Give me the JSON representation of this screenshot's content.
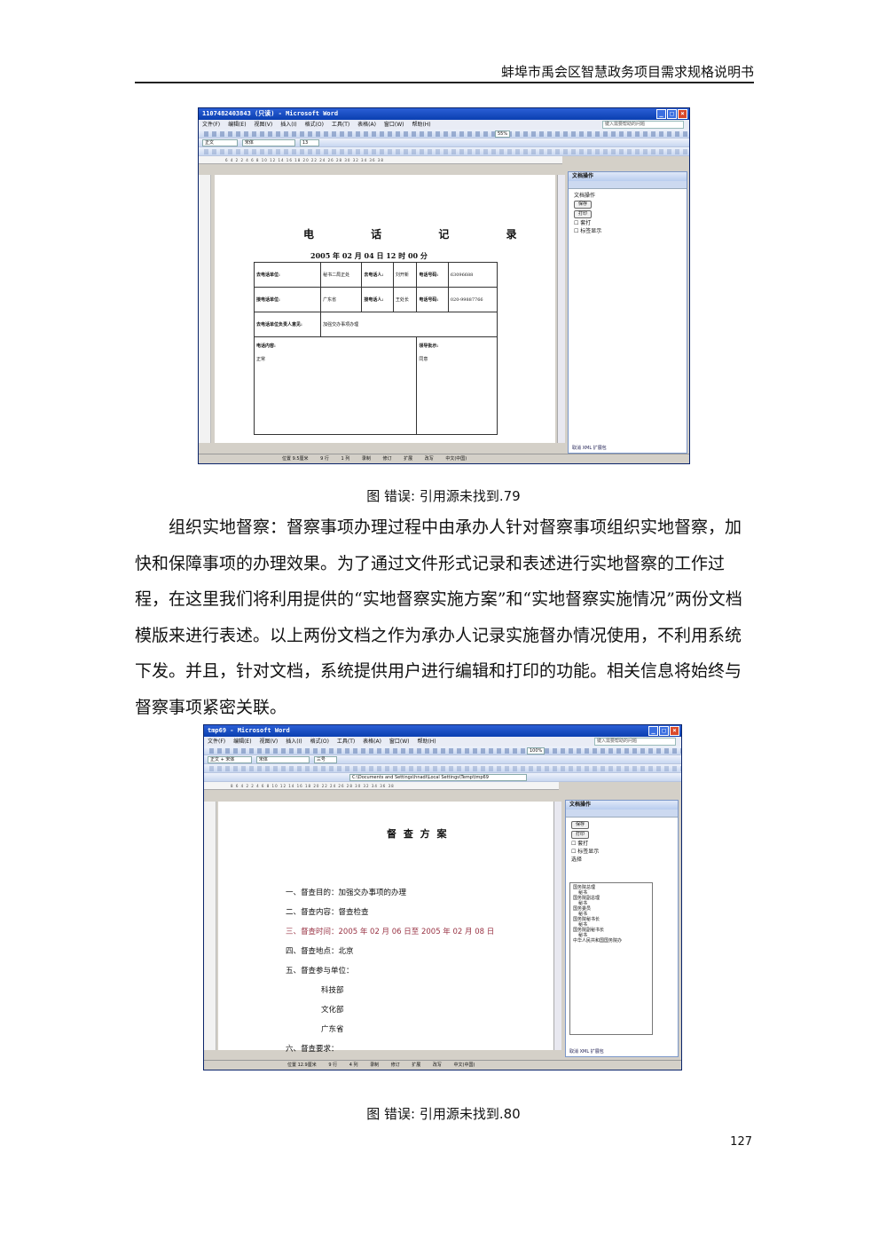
{
  "header": {
    "title": "蚌埠市禹会区智慧政务项目需求规格说明书"
  },
  "figure1": {
    "caption": "图  错误: 引用源未找到.79",
    "window_title": "1107482403843 (只读) - Microsoft Word",
    "menu": [
      "文件(F)",
      "编辑(E)",
      "视图(V)",
      "插入(I)",
      "格式(O)",
      "工具(T)",
      "表格(A)",
      "窗口(W)",
      "帮助(H)"
    ],
    "help_placeholder": "键入需要帮助的问题",
    "style_value": "正文",
    "font_value": "宋体",
    "size_value": "13",
    "zoom_value": "55%",
    "ruler": "6  4  2     2  4  6  8  10  12  14  16  18  20  22  24  26  28  30  32  34  36  38",
    "doc": {
      "title": "电 话 记 录",
      "datetime": "2005 年 02 月 04 日 12 时 00 分",
      "rows": [
        [
          "去电话单位:",
          "秘书二局正处",
          "去电话人:",
          "刘开新",
          "电话号码:",
          "63096688"
        ],
        [
          "接电话单位:",
          "广东省",
          "接电话人:",
          "王处长",
          "电话号码:",
          "020-99887766"
        ]
      ],
      "opinion_label": "去电话单位负责人意见:",
      "opinion_value": "加强交办事项办理",
      "content_label": "电话内容:",
      "content_value": "正常",
      "leader_label": "领导批示:",
      "leader_value": "同意"
    },
    "taskpane": {
      "title": "文档操作",
      "section": "文档操作",
      "save": "保存",
      "print": "打印",
      "check1": "套打",
      "check2": "标签显示",
      "footer": "取消 XML 扩展包"
    },
    "status": [
      "位置 9.5厘米",
      "9 行",
      "1 列",
      "录制",
      "修订",
      "扩展",
      "改写",
      "中文(中国)"
    ]
  },
  "body": {
    "paragraph": "组织实地督察：督察事项办理过程中由承办人针对督察事项组织实地督察，加快和保障事项的办理效果。为了通过文件形式记录和表述进行实地督察的工作过程，在这里我们将利用提供的“实地督察实施方案”和“实地督察实施情况”两份文档模版来进行表述。以上两份文档之作为承办人记录实施督办情况使用，不利用系统下发。并且，针对文档，系统提供用户进行编辑和打印的功能。相关信息将始终与督察事项紧密关联。"
  },
  "figure2": {
    "caption": "图  错误: 引用源未找到.80",
    "window_title": "tmp69 - Microsoft Word",
    "menu": [
      "文件(F)",
      "编辑(E)",
      "视图(V)",
      "插入(I)",
      "格式(O)",
      "工具(T)",
      "表格(A)",
      "窗口(W)",
      "帮助(H)"
    ],
    "help_placeholder": "键入需要帮助的问题",
    "style_value": "正文 + 宋体",
    "font_value": "宋体",
    "size_value": "三号",
    "zoom_value": "100%",
    "path_value": "C:\\Documents and Settings\\hnadi\\Local Settings\\Temp\\tmp69",
    "ruler": "8  6  4  2     2  4  6  8  10  12  14  16  18  20  22  24  26  28  30  32  34  36  38",
    "doc": {
      "title": "督 查 方 案",
      "items": [
        "一、督查目的：加强交办事项的办理",
        "二、督查内容：督查检查",
        "三、督查时间：2005 年 02 月 06 日至 2005 年 02 月 08 日",
        "四、督查地点：北京",
        "五、督查参与单位：",
        "六、督查要求："
      ],
      "units": [
        "科技部",
        "文化部",
        "广东省"
      ]
    },
    "taskpane": {
      "title": "文档操作",
      "save": "保存",
      "print": "打印",
      "check1": "套打",
      "check2": "标签显示",
      "select_label": "选择",
      "tree": [
        "国务院总理",
        "秘书",
        "国务院副总理",
        "秘书",
        "国务委员",
        "秘书",
        "国务院秘书长",
        "秘书",
        "国务院副秘书长",
        "秘书",
        "中华人民共和国国务院办"
      ],
      "footer": "取消 XML 扩展包"
    },
    "status": [
      "位置 12.9厘米",
      "9 行",
      "4 列",
      "录制",
      "修订",
      "扩展",
      "改写",
      "中文(中国)"
    ]
  },
  "page_number": "127"
}
